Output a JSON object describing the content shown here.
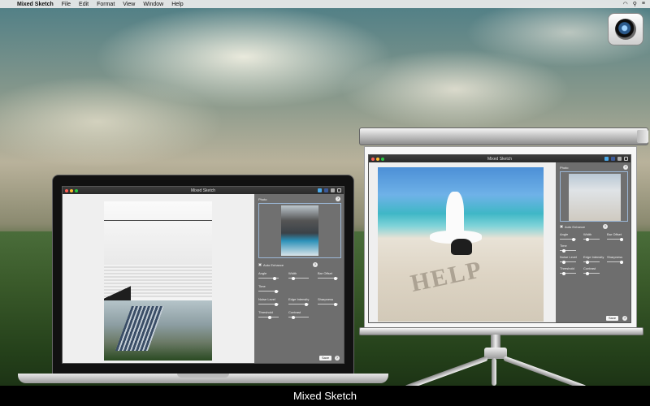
{
  "menubar": {
    "apple": "",
    "app_name": "Mixed Sketch",
    "menus": [
      "File",
      "Edit",
      "Format",
      "View",
      "Window",
      "Help"
    ],
    "status": {
      "wifi": "wifi-icon",
      "search": "search-icon",
      "list": "list-icon"
    }
  },
  "window": {
    "title": "Mixed Sketch",
    "icons": [
      "twitter-icon",
      "facebook-icon",
      "share-icon",
      "help-icon"
    ]
  },
  "panel": {
    "photo_label": "Photo",
    "auto_enhance_label": "Auto Enhance",
    "help": "?",
    "sliders": {
      "angle": "Angle",
      "width": "Width",
      "bar_offset": "Bar Offset",
      "time": "Time",
      "noise_level": "Noise Level",
      "edge_intensity": "Edge Intensity",
      "sharpness": "Sharpness",
      "threshold": "Threshold",
      "contrast": "Contrast"
    },
    "save_label": "Save"
  },
  "beach": {
    "sand_text": "HELP"
  },
  "caption": "Mixed Sketch"
}
